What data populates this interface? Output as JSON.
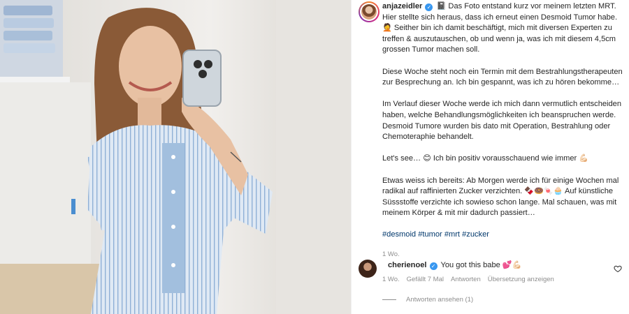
{
  "post": {
    "username": "anjazeidler",
    "paragraphs": [
      "📓 Das Foto entstand kurz vor meinem letzten MRT. Hier stellte sich heraus, dass ich erneut einen Desmoid Tumor habe. 🤦 Seither bin ich damit beschäftigt, mich mit diversen Experten zu treffen & auszutauschen, ob und wenn ja, was ich mit diesem 4,5cm grossen Tumor machen soll.",
      "Diese Woche steht noch ein Termin mit dem Bestrahlungstherapeuten zur Besprechung an. Ich bin gespannt, was ich zu hören bekomme…",
      "Im Verlauf dieser Woche werde ich mich dann vermutlich entscheiden haben, welche Behandlungsmöglichkeiten ich beanspruchen werde. Desmoid Tumore wurden bis dato mit Operation, Bestrahlung oder Chemoteraphie behandelt.",
      "Let's see… 😊 Ich bin positiv vorausschauend wie immer 💪🏻",
      "Etwas weiss ich bereits: Ab Morgen werde ich für einige Wochen mal radikal auf raffinierten Zucker verzichten. 🍫🍩🍬🧁 Auf künstliche Süssstoffe verzichte ich sowieso schon lange. Mal schauen, was mit meinem Körper & mit mir dadurch passiert…"
    ],
    "hashtags": [
      "#desmoid",
      "#tumor",
      "#mrt",
      "#zucker"
    ],
    "age": "1 Wo."
  },
  "comment": {
    "username": "cherienoel",
    "text": "You got this babe 💕💪🏻",
    "age": "1 Wo.",
    "likes": "Gefällt 7 Mal",
    "reply_label": "Antworten",
    "translate_label": "Übersetzung anzeigen",
    "view_replies": "Antworten ansehen (1)"
  },
  "icons": {
    "verified": "verified-badge-icon",
    "like": "heart-outline-icon"
  },
  "colors": {
    "link": "#00376b",
    "verified": "#3897f0",
    "muted": "#8e8e8e"
  }
}
